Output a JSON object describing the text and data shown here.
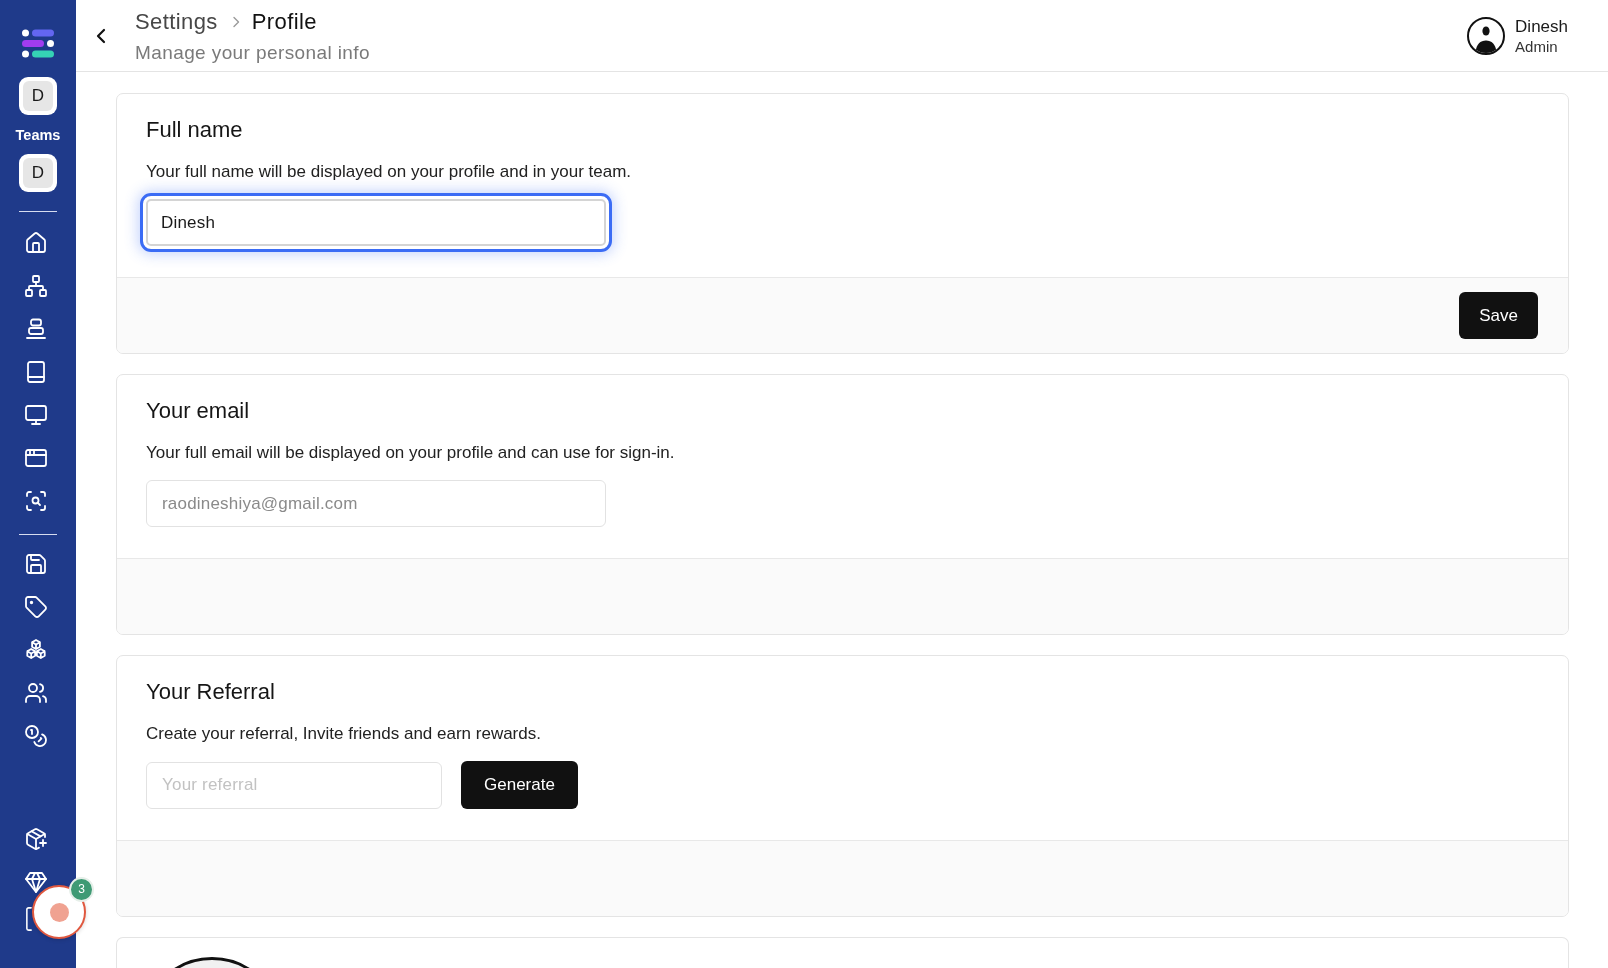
{
  "sidebar": {
    "account": {
      "initial": "D"
    },
    "teams": {
      "label": "Teams",
      "items": [
        {
          "initial": "D"
        }
      ]
    }
  },
  "header": {
    "breadcrumb": [
      {
        "label": "Settings",
        "current": false
      },
      {
        "label": "Profile",
        "current": true
      }
    ],
    "subtitle": "Manage your personal info",
    "user": {
      "name": "Dinesh",
      "role": "Admin"
    }
  },
  "cards": [
    {
      "kind": "form",
      "title": "Full name",
      "description": "Your full name will be displayed on your profile and in your team.",
      "field": {
        "value": "Dinesh",
        "focused": true,
        "disabled": false
      },
      "footer_button": "Save"
    },
    {
      "kind": "form",
      "title": "Your email",
      "description": "Your full email will be displayed on your profile and can use for sign-in.",
      "field": {
        "value": "raodineshiya@gmail.com",
        "focused": false,
        "disabled": true
      }
    },
    {
      "kind": "form",
      "title": "Your Referral",
      "description": "Create your referral, Invite friends and earn rewards.",
      "field": {
        "placeholder": "Your referral",
        "focused": false,
        "disabled": false
      },
      "inline_button": "Generate"
    },
    {
      "kind": "photo"
    }
  ],
  "floating_widget": {
    "badge": "3"
  }
}
